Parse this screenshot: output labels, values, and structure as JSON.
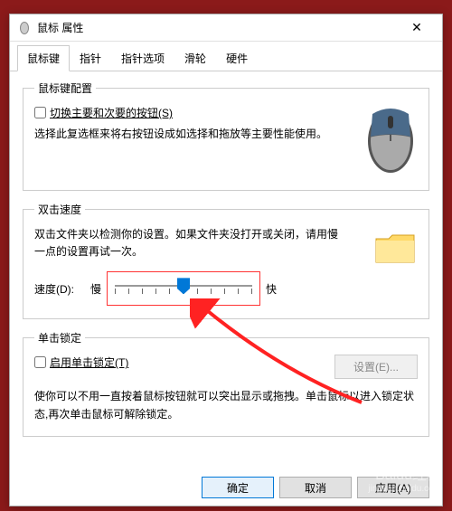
{
  "window": {
    "title": "鼠标 属性",
    "close": "✕"
  },
  "tabs": [
    "鼠标键",
    "指针",
    "指针选项",
    "滑轮",
    "硬件"
  ],
  "section1": {
    "legend": "鼠标键配置",
    "checkbox": "切换主要和次要的按钮(S)",
    "desc": "选择此复选框来将右按钮设成如选择和拖放等主要性能使用。"
  },
  "section2": {
    "legend": "双击速度",
    "desc": "双击文件夹以检测你的设置。如果文件夹没打开或关闭，请用慢一点的设置再试一次。",
    "speed_label": "速度(D):",
    "slow": "慢",
    "fast": "快",
    "value": 5,
    "max": 10
  },
  "section3": {
    "legend": "单击锁定",
    "checkbox": "启用单击锁定(T)",
    "settings_btn": "设置(E)...",
    "desc": "使你可以不用一直按着鼠标按钮就可以突出显示或拖拽。单击鼠标以进入锁定状态,再次单击鼠标可解除锁定。"
  },
  "footer": {
    "ok": "确定",
    "cancel": "取消",
    "apply": "应用(A)"
  },
  "watermark": {
    "main": "Baidu经验",
    "sub": "jingyan.baidu.com"
  }
}
